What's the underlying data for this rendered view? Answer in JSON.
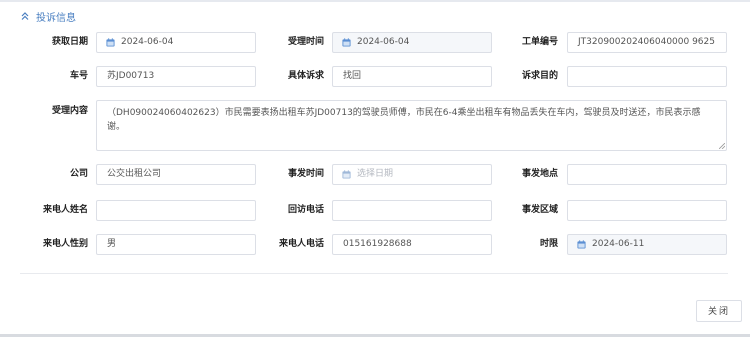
{
  "section": {
    "title": "投诉信息",
    "icon": "chevrons-up-icon"
  },
  "labels": {
    "get_date": "获取日期",
    "accept_time": "受理时间",
    "ticket_no": "工单编号",
    "plate": "车号",
    "specific_appeal": "具体诉求",
    "appeal_purpose": "诉求目的",
    "accept_content": "受理内容",
    "company": "公司",
    "incident_time": "事发时间",
    "incident_place": "事发地点",
    "caller_name": "来电人姓名",
    "callback_phone": "回访电话",
    "incident_area": "事发区域",
    "caller_gender": "来电人性别",
    "caller_phone": "来电人电话",
    "time_limit": "时限"
  },
  "values": {
    "get_date": "2024-06-04",
    "accept_time": "2024-06-04",
    "ticket_no": "JT320900202406040000 9625",
    "plate": "苏JD00713",
    "specific_appeal": "找回",
    "appeal_purpose": "",
    "accept_content": "（DH090024060402623）市民需要表扬出租车苏JD00713的驾驶员师傅，市民在6-4乘坐出租车有物品丢失在车内，驾驶员及时送还，市民表示感谢。",
    "company": "公交出租公司",
    "incident_time_placeholder": "选择日期",
    "incident_place": "",
    "caller_name": "",
    "callback_phone": "",
    "incident_area": "",
    "caller_gender": "男",
    "caller_phone": "015161928688",
    "time_limit": "2024-06-11"
  },
  "buttons": {
    "close": "关闭"
  },
  "colors": {
    "accent": "#4a7fc1",
    "border": "#dcdfe6",
    "disabled_bg": "#f5f7fa",
    "icon": "#5b8fd3"
  }
}
